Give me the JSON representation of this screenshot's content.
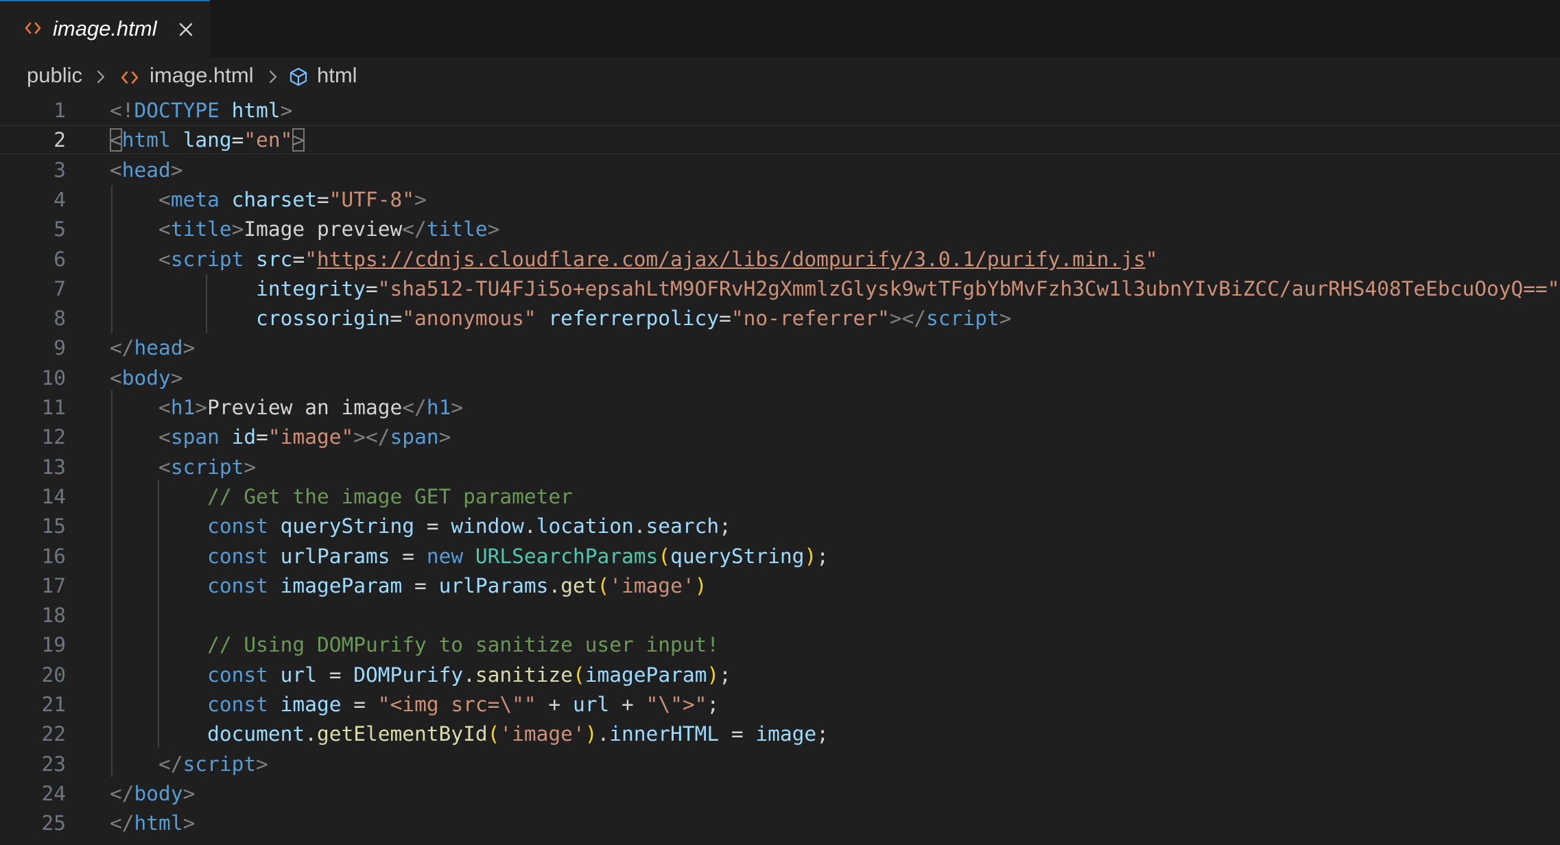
{
  "tab": {
    "label": "image.html",
    "icon": "html-code-icon",
    "accent": "#e37933"
  },
  "breadcrumb": {
    "items": [
      "public",
      "image.html",
      "html"
    ]
  },
  "editor": {
    "active_line": 2,
    "colors": {
      "background": "#1f1f1f",
      "tag_bracket": "#808080",
      "tag_name": "#569cd6",
      "attribute": "#9cdcfe",
      "string": "#ce9178",
      "comment": "#6a9955",
      "function": "#dcdcaa",
      "class": "#4ec9b0",
      "paren_outer": "#ffd700"
    },
    "lines": [
      {
        "n": "1",
        "tokens": [
          [
            "tag",
            "<!"
          ],
          [
            "name",
            "DOCTYPE"
          ],
          [
            "text",
            " "
          ],
          [
            "attr",
            "html"
          ],
          [
            "tag",
            ">"
          ]
        ]
      },
      {
        "n": "2",
        "tokens": [
          [
            "tag",
            "<"
          ],
          [
            "name",
            "html"
          ],
          [
            "text",
            " "
          ],
          [
            "attr",
            "lang"
          ],
          [
            "text",
            "="
          ],
          [
            "str",
            "\"en\""
          ],
          [
            "tag",
            ">"
          ]
        ]
      },
      {
        "n": "3",
        "tokens": [
          [
            "tag",
            "<"
          ],
          [
            "name",
            "head"
          ],
          [
            "tag",
            ">"
          ]
        ]
      },
      {
        "n": "4",
        "tokens": [
          [
            "text",
            "    "
          ],
          [
            "tag",
            "<"
          ],
          [
            "name",
            "meta"
          ],
          [
            "text",
            " "
          ],
          [
            "attr",
            "charset"
          ],
          [
            "text",
            "="
          ],
          [
            "str",
            "\"UTF-8\""
          ],
          [
            "tag",
            ">"
          ]
        ]
      },
      {
        "n": "5",
        "tokens": [
          [
            "text",
            "    "
          ],
          [
            "tag",
            "<"
          ],
          [
            "name",
            "title"
          ],
          [
            "tag",
            ">"
          ],
          [
            "text",
            "Image preview"
          ],
          [
            "tag",
            "</"
          ],
          [
            "name",
            "title"
          ],
          [
            "tag",
            ">"
          ]
        ]
      },
      {
        "n": "6",
        "tokens": [
          [
            "text",
            "    "
          ],
          [
            "tag",
            "<"
          ],
          [
            "name",
            "script"
          ],
          [
            "text",
            " "
          ],
          [
            "attr",
            "src"
          ],
          [
            "text",
            "="
          ],
          [
            "str",
            "\""
          ],
          [
            "url",
            "https://cdnjs.cloudflare.com/ajax/libs/dompurify/3.0.1/purify.min.js"
          ],
          [
            "str",
            "\""
          ]
        ]
      },
      {
        "n": "7",
        "tokens": [
          [
            "text",
            "            "
          ],
          [
            "attr",
            "integrity"
          ],
          [
            "text",
            "="
          ],
          [
            "str",
            "\"sha512-TU4FJi5o+epsahLtM9OFRvH2gXmmlzGlysk9wtTFgbYbMvFzh3Cw1l3ubnYIvBiZCC/aurRHS408TeEbcuOoyQ==\""
          ]
        ]
      },
      {
        "n": "8",
        "tokens": [
          [
            "text",
            "            "
          ],
          [
            "attr",
            "crossorigin"
          ],
          [
            "text",
            "="
          ],
          [
            "str",
            "\"anonymous\""
          ],
          [
            "text",
            " "
          ],
          [
            "attr",
            "referrerpolicy"
          ],
          [
            "text",
            "="
          ],
          [
            "str",
            "\"no-referrer\""
          ],
          [
            "tag",
            "></"
          ],
          [
            "name",
            "script"
          ],
          [
            "tag",
            ">"
          ]
        ]
      },
      {
        "n": "9",
        "tokens": [
          [
            "tag",
            "</"
          ],
          [
            "name",
            "head"
          ],
          [
            "tag",
            ">"
          ]
        ]
      },
      {
        "n": "10",
        "tokens": [
          [
            "tag",
            "<"
          ],
          [
            "name",
            "body"
          ],
          [
            "tag",
            ">"
          ]
        ]
      },
      {
        "n": "11",
        "tokens": [
          [
            "text",
            "    "
          ],
          [
            "tag",
            "<"
          ],
          [
            "name",
            "h1"
          ],
          [
            "tag",
            ">"
          ],
          [
            "text",
            "Preview an image"
          ],
          [
            "tag",
            "</"
          ],
          [
            "name",
            "h1"
          ],
          [
            "tag",
            ">"
          ]
        ]
      },
      {
        "n": "12",
        "tokens": [
          [
            "text",
            "    "
          ],
          [
            "tag",
            "<"
          ],
          [
            "name",
            "span"
          ],
          [
            "text",
            " "
          ],
          [
            "attr",
            "id"
          ],
          [
            "text",
            "="
          ],
          [
            "str",
            "\"image\""
          ],
          [
            "tag",
            "></"
          ],
          [
            "name",
            "span"
          ],
          [
            "tag",
            ">"
          ]
        ]
      },
      {
        "n": "13",
        "tokens": [
          [
            "text",
            "    "
          ],
          [
            "tag",
            "<"
          ],
          [
            "name",
            "script"
          ],
          [
            "tag",
            ">"
          ]
        ]
      },
      {
        "n": "14",
        "tokens": [
          [
            "text",
            "        "
          ],
          [
            "com",
            "// Get the image GET parameter"
          ]
        ]
      },
      {
        "n": "15",
        "tokens": [
          [
            "text",
            "        "
          ],
          [
            "kw",
            "const"
          ],
          [
            "text",
            " "
          ],
          [
            "var",
            "queryString"
          ],
          [
            "op",
            " = "
          ],
          [
            "var",
            "window"
          ],
          [
            "op",
            "."
          ],
          [
            "var",
            "location"
          ],
          [
            "op",
            "."
          ],
          [
            "var",
            "search"
          ],
          [
            "op",
            ";"
          ]
        ]
      },
      {
        "n": "16",
        "tokens": [
          [
            "text",
            "        "
          ],
          [
            "kw",
            "const"
          ],
          [
            "text",
            " "
          ],
          [
            "var",
            "urlParams"
          ],
          [
            "op",
            " = "
          ],
          [
            "kw",
            "new"
          ],
          [
            "text",
            " "
          ],
          [
            "cls",
            "URLSearchParams"
          ],
          [
            "p1",
            "("
          ],
          [
            "var",
            "queryString"
          ],
          [
            "p1",
            ")"
          ],
          [
            "op",
            ";"
          ]
        ]
      },
      {
        "n": "17",
        "tokens": [
          [
            "text",
            "        "
          ],
          [
            "kw",
            "const"
          ],
          [
            "text",
            " "
          ],
          [
            "var",
            "imageParam"
          ],
          [
            "op",
            " = "
          ],
          [
            "var",
            "urlParams"
          ],
          [
            "op",
            "."
          ],
          [
            "fn",
            "get"
          ],
          [
            "p1",
            "("
          ],
          [
            "str",
            "'image'"
          ],
          [
            "p1",
            ")"
          ]
        ]
      },
      {
        "n": "18",
        "tokens": []
      },
      {
        "n": "19",
        "tokens": [
          [
            "text",
            "        "
          ],
          [
            "com",
            "// Using DOMPurify to sanitize user input!"
          ]
        ]
      },
      {
        "n": "20",
        "tokens": [
          [
            "text",
            "        "
          ],
          [
            "kw",
            "const"
          ],
          [
            "text",
            " "
          ],
          [
            "var",
            "url"
          ],
          [
            "op",
            " = "
          ],
          [
            "var",
            "DOMPurify"
          ],
          [
            "op",
            "."
          ],
          [
            "fn",
            "sanitize"
          ],
          [
            "p1",
            "("
          ],
          [
            "var",
            "imageParam"
          ],
          [
            "p1",
            ")"
          ],
          [
            "op",
            ";"
          ]
        ]
      },
      {
        "n": "21",
        "tokens": [
          [
            "text",
            "        "
          ],
          [
            "kw",
            "const"
          ],
          [
            "text",
            " "
          ],
          [
            "var",
            "image"
          ],
          [
            "op",
            " = "
          ],
          [
            "str",
            "\"<img src=\\\"\""
          ],
          [
            "op",
            " + "
          ],
          [
            "var",
            "url"
          ],
          [
            "op",
            " + "
          ],
          [
            "str",
            "\"\\\">\""
          ],
          [
            "op",
            ";"
          ]
        ]
      },
      {
        "n": "22",
        "tokens": [
          [
            "text",
            "        "
          ],
          [
            "var",
            "document"
          ],
          [
            "op",
            "."
          ],
          [
            "fn",
            "getElementById"
          ],
          [
            "p1",
            "("
          ],
          [
            "str",
            "'image'"
          ],
          [
            "p1",
            ")"
          ],
          [
            "op",
            "."
          ],
          [
            "var",
            "innerHTML"
          ],
          [
            "op",
            " = "
          ],
          [
            "var",
            "image"
          ],
          [
            "op",
            ";"
          ]
        ]
      },
      {
        "n": "23",
        "tokens": [
          [
            "text",
            "    "
          ],
          [
            "tag",
            "</"
          ],
          [
            "name",
            "script"
          ],
          [
            "tag",
            ">"
          ]
        ]
      },
      {
        "n": "24",
        "tokens": [
          [
            "tag",
            "</"
          ],
          [
            "name",
            "body"
          ],
          [
            "tag",
            ">"
          ]
        ]
      },
      {
        "n": "25",
        "tokens": [
          [
            "tag",
            "</"
          ],
          [
            "name",
            "html"
          ],
          [
            "tag",
            ">"
          ]
        ]
      }
    ]
  }
}
